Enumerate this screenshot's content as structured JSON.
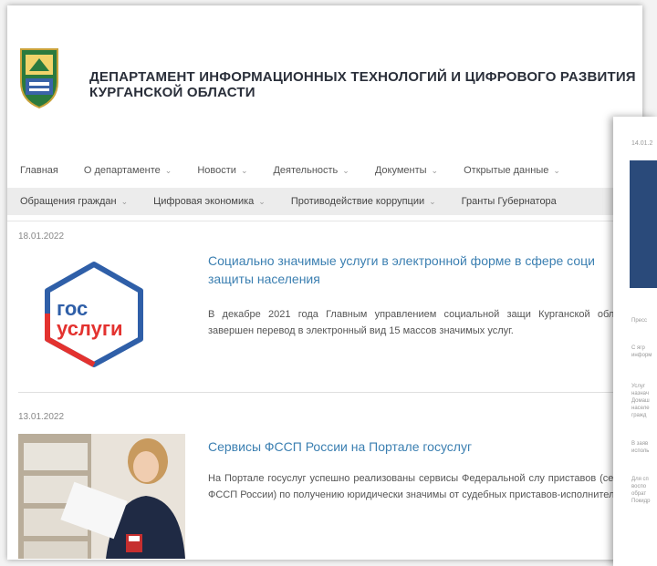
{
  "site": {
    "title_line1": "ДЕПАРТАМЕНТ ИНФОРМАЦИОННЫХ ТЕХНОЛОГИЙ И ЦИФРОВОГО РАЗВИТИЯ",
    "title_line2": "КУРГАНСКОЙ ОБЛАСТИ",
    "crest_icon": "coat-of-arms-icon"
  },
  "nav_primary": [
    {
      "label": "Главная",
      "has_dropdown": false
    },
    {
      "label": "О департаменте",
      "has_dropdown": true
    },
    {
      "label": "Новости",
      "has_dropdown": true
    },
    {
      "label": "Деятельность",
      "has_dropdown": true
    },
    {
      "label": "Документы",
      "has_dropdown": true
    },
    {
      "label": "Открытые данные",
      "has_dropdown": true
    }
  ],
  "nav_secondary": [
    {
      "label": "Обращения граждан",
      "has_dropdown": true
    },
    {
      "label": "Цифровая экономика",
      "has_dropdown": true
    },
    {
      "label": "Противодействие коррупции",
      "has_dropdown": true
    },
    {
      "label": "Гранты Губернатора",
      "has_dropdown": false
    }
  ],
  "news": [
    {
      "date": "18.01.2022",
      "title": "Социально значимые услуги в электронной форме в сфере соци защиты населения",
      "text": "В декабре 2021 года Главным управлением социальной защи Курганской области завершен перевод в электронный вид 15 массов значимых услуг.",
      "logo_line1": "гос",
      "logo_line2": "услуги"
    },
    {
      "date": "13.01.2022",
      "title": "Сервисы ФССП России на Портале госуслуг",
      "text": "На Портале госуслуг успешно реализованы сервисы Федеральной слу приставов (сервис ФССП России) по получению юридически значимы от судебных приставов-исполнителей."
    }
  ],
  "overlay": {
    "date": "14.01.2",
    "lines": [
      "Пресс",
      "С ягр",
      "информ",
      "Услуг",
      "назнач",
      "Домаш",
      "населе",
      "гражд",
      "В заяв",
      "исполь",
      "Для сп",
      "воспо",
      "обрат",
      "Покидр"
    ]
  },
  "colors": {
    "link": "#3b7fb1",
    "gos_blue": "#2f5fa8",
    "gos_red": "#e3322f"
  }
}
